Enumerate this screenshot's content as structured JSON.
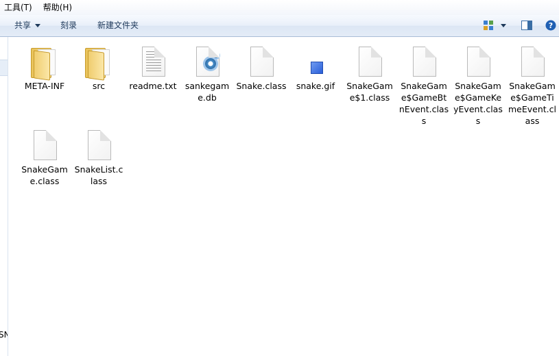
{
  "menubar": {
    "items": [
      "工具(T)",
      "帮助(H)"
    ]
  },
  "toolbar": {
    "share_label": "共享",
    "burn_label": "刻录",
    "new_folder_label": "新建文件夹"
  },
  "navpane": {
    "fragment_text": "SN"
  },
  "files": [
    {
      "name": "META-INF",
      "type": "folder"
    },
    {
      "name": "src",
      "type": "folder"
    },
    {
      "name": "readme.txt",
      "type": "text"
    },
    {
      "name": "sankegame.db",
      "type": "db"
    },
    {
      "name": "Snake.class",
      "type": "class"
    },
    {
      "name": "snake.gif",
      "type": "gif"
    },
    {
      "name": "SnakeGame$1.class",
      "type": "class"
    },
    {
      "name": "SnakeGame$GameBtnEvent.class",
      "type": "class"
    },
    {
      "name": "SnakeGame$GameKeyEvent.class",
      "type": "class"
    },
    {
      "name": "SnakeGame$GameTimeEvent.class",
      "type": "class"
    },
    {
      "name": "SnakeGame.class",
      "type": "class"
    },
    {
      "name": "SnakeList.class",
      "type": "class"
    }
  ],
  "colors": {
    "toolbar_text": "#1e395b",
    "folder": "#f0cd6f",
    "help_icon": "#1f5fb3"
  }
}
